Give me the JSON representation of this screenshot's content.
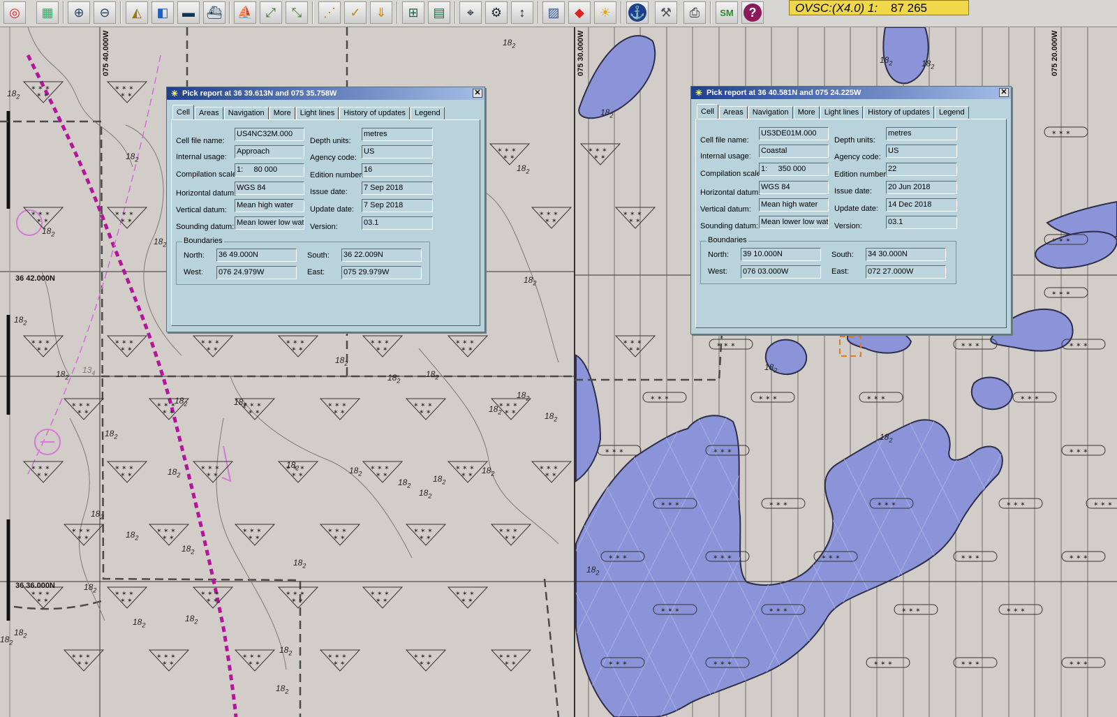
{
  "toolbar": {
    "icons": [
      "lifebuoy-icon",
      "calendar-add-icon",
      "zoom-in-icon",
      "zoom-out-icon",
      "plane-icon",
      "layers-icon",
      "ship-lowered-icon",
      "ship-outline-icon",
      "ship-hull-icon",
      "measure-icon",
      "route-icon",
      "network-icon",
      "check-icon",
      "download-icon",
      "add-chart-icon",
      "book-icon",
      "target-icon",
      "settings-target-icon",
      "scale-icon",
      "chart-doc-icon",
      "color-palette-icon",
      "weather-icon",
      "anchor-icon",
      "hammer-icon",
      "printer-icon",
      "sm-icon",
      "help-icon"
    ],
    "scale_prefix": "OVSC:",
    "scale_zoom": "(X4.0) 1:",
    "scale_value": "87 265"
  },
  "chart": {
    "coords": {
      "lon_1": "075 40.000W",
      "lon_2": "075 30.000W",
      "lon_3": "075 20.000W",
      "lat_1": "36 42.000N",
      "lat_2": "36 36.000N"
    },
    "depth_main": "18",
    "depth_sub": "2",
    "depth_13": "13",
    "depth_13_sub": "4",
    "colors": {
      "land": "#d3cdc9",
      "shoal": "#8b94d8",
      "route": "#b3159b"
    }
  },
  "dialog1": {
    "title": "Pick report at 36 39.613N and 075 35.758W",
    "tabs": [
      "Cell",
      "Areas",
      "Navigation",
      "More",
      "Light lines",
      "History of updates",
      "Legend"
    ],
    "active_tab": "Cell",
    "labels": {
      "cell_file": "Cell file name:",
      "usage": "Internal usage:",
      "comp_scale": "Compilation scale:",
      "h_datum": "Horizontal datum:",
      "v_datum": "Vertical datum:",
      "s_datum": "Sounding datum:",
      "depth_units": "Depth units:",
      "agency": "Agency code:",
      "edition": "Edition number:",
      "issue": "Issue date:",
      "update": "Update date:",
      "version": "Version:",
      "boundaries": "Boundaries",
      "north": "North:",
      "south": "South:",
      "west": "West:",
      "east": "East:"
    },
    "values": {
      "cell_file": "US4NC32M.000",
      "usage": "Approach",
      "comp_scale": "1:     80 000",
      "h_datum": "WGS 84",
      "v_datum": "Mean high water",
      "s_datum": "Mean lower low wate",
      "depth_units": "metres",
      "agency": "US",
      "edition": "16",
      "issue": "7 Sep 2018",
      "update": "7 Sep 2018",
      "version": "03.1",
      "north": "36 49.000N",
      "south": "36 22.009N",
      "west": "076 24.979W",
      "east": "075 29.979W"
    }
  },
  "dialog2": {
    "title": "Pick report at 36 40.581N and 075 24.225W",
    "tabs": [
      "Cell",
      "Areas",
      "Navigation",
      "More",
      "Light lines",
      "History of updates",
      "Legend"
    ],
    "active_tab": "Cell",
    "labels": {
      "cell_file": "Cell file name:",
      "usage": "Internal usage:",
      "comp_scale": "Compilation scale:",
      "h_datum": "Horizontal datum:",
      "v_datum": "Vertical datum:",
      "s_datum": "Sounding datum:",
      "depth_units": "Depth units:",
      "agency": "Agency code:",
      "edition": "Edition number:",
      "issue": "Issue date:",
      "update": "Update date:",
      "version": "Version:",
      "boundaries": "Boundaries",
      "north": "North:",
      "south": "South:",
      "west": "West:",
      "east": "East:"
    },
    "values": {
      "cell_file": "US3DE01M.000",
      "usage": "Coastal",
      "comp_scale": "1:     350 000",
      "h_datum": "WGS 84",
      "v_datum": "Mean high water",
      "s_datum": "Mean lower low wate",
      "depth_units": "metres",
      "agency": "US",
      "edition": "22",
      "issue": "20 Jun 2018",
      "update": "14 Dec 2018",
      "version": "03.1",
      "north": "39 10.000N",
      "south": "34 30.000N",
      "west": "076 03.000W",
      "east": "072 27.000W"
    }
  }
}
